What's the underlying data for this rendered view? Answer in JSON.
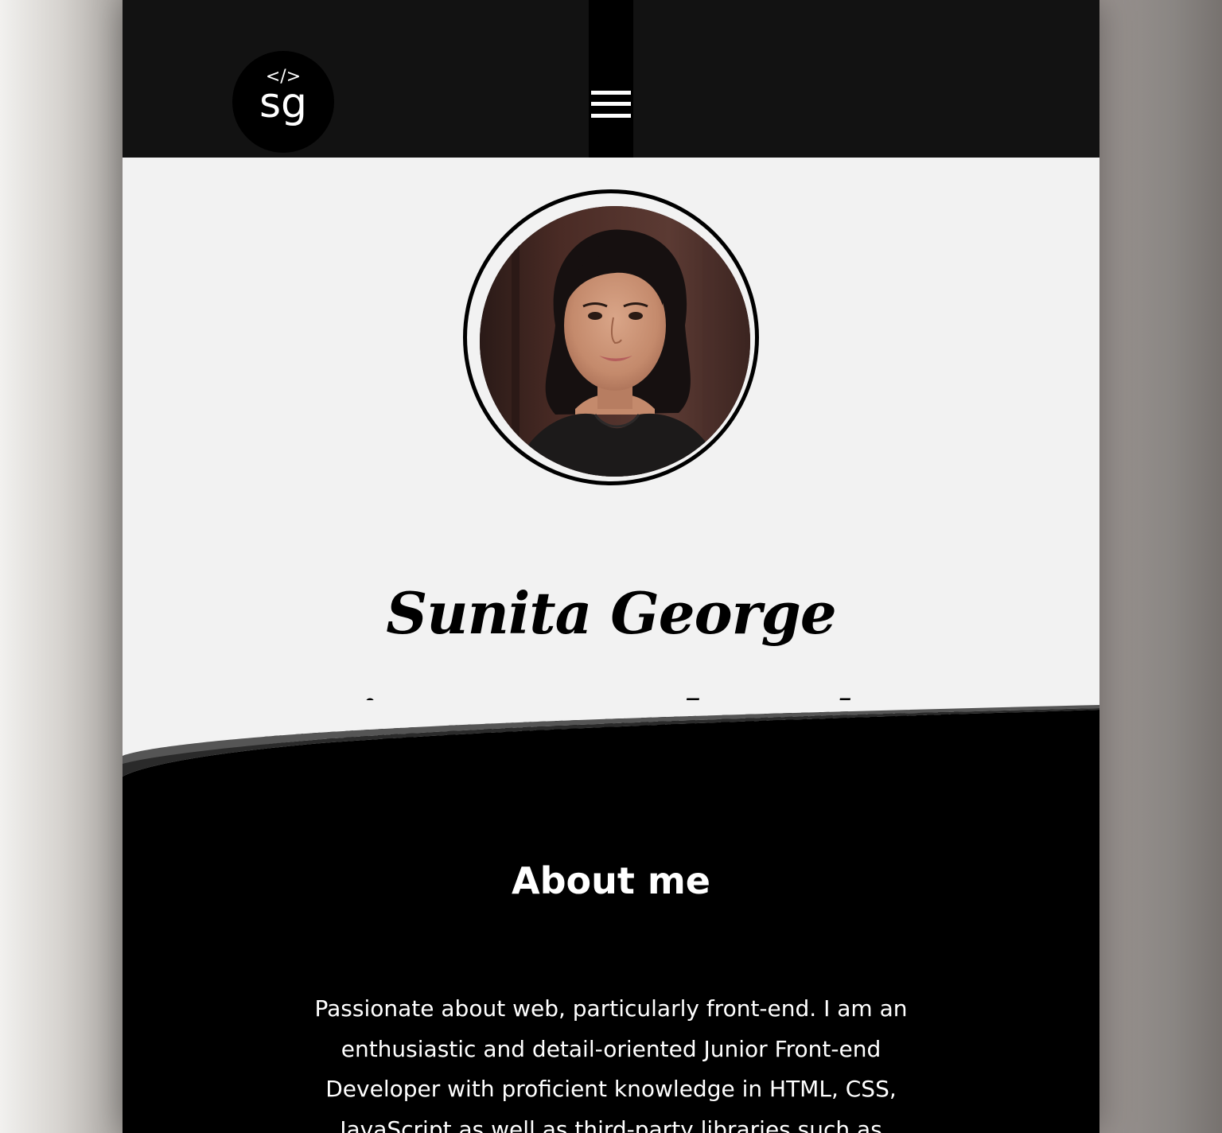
{
  "header": {
    "logo": {
      "code_symbol": "</>",
      "initials": "sg"
    },
    "menu_icon": "hamburger-menu-icon"
  },
  "hero": {
    "portrait_alt": "Portrait photo of Sunita George",
    "name": "Sunita George",
    "role": "Junior Front End Developer"
  },
  "about": {
    "title": "About me",
    "text": "Passionate about web, particularly front-end. I am an enthusiastic and detail-oriented Junior Front-end Developer with proficient knowledge in HTML, CSS, JavaScript as well as third-party libraries such as"
  },
  "colors": {
    "header_bg": "#121212",
    "hero_bg": "#f2f2f2",
    "about_bg": "#000000",
    "text_dark": "#000000",
    "text_light": "#ffffff"
  }
}
